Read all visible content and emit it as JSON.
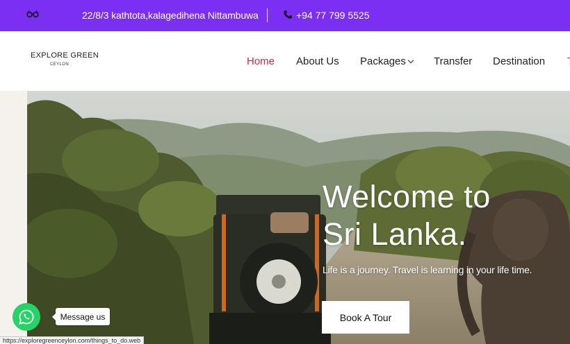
{
  "topbar": {
    "address": "22/8/3 kathtota,kalagedihena Nittambuwa",
    "phone": "+94 77 799 5525",
    "bg_color": "#7a2ff2",
    "icons": [
      "glasses-icon",
      "phone-icon"
    ]
  },
  "header": {
    "logo_main": "EXPLORE GREEN",
    "logo_sub": "CEYLON",
    "nav": {
      "home": "Home",
      "about": "About Us",
      "packages": "Packages",
      "transfer": "Transfer",
      "destination": "Destination"
    },
    "active_color": "#d2283c"
  },
  "hero": {
    "title_line1": "Welcome to",
    "title_line2": "Sri Lanka.",
    "subtitle": "Life is a journey. Travel is learning in your life time.",
    "button_label": "Book A Tour"
  },
  "whatsapp": {
    "tooltip": "Message us",
    "color": "#25d366"
  },
  "status_bar": {
    "url": "https://exploregreenceylon.com/things_to_do.web"
  }
}
